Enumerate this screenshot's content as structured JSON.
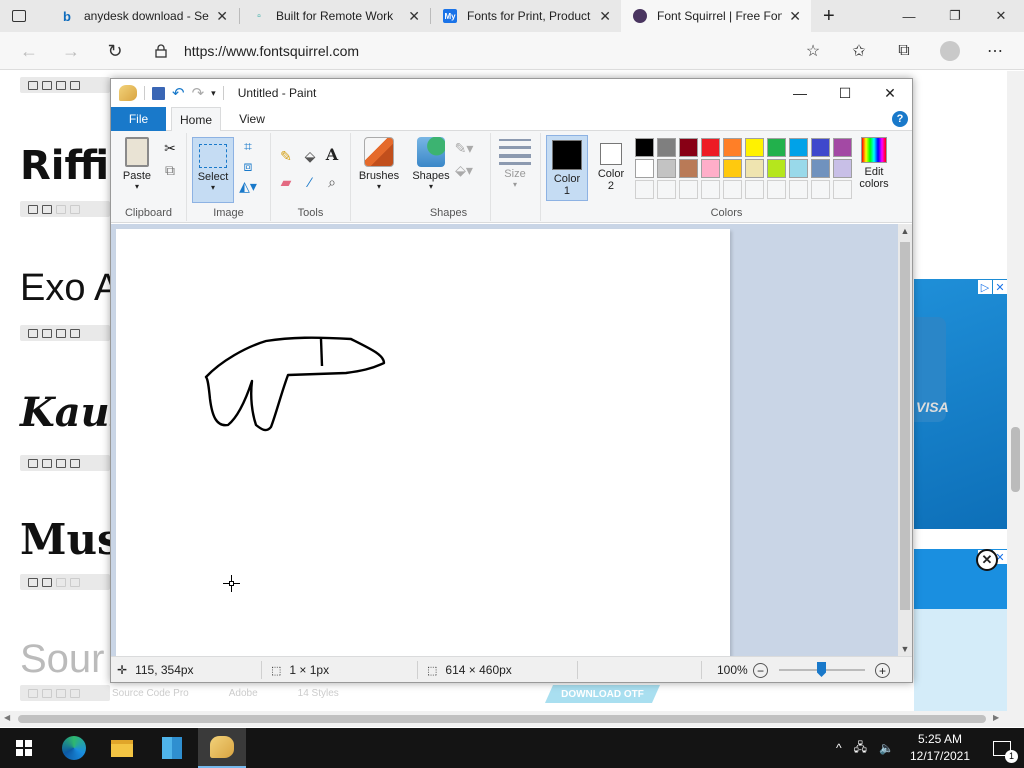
{
  "browser": {
    "tabs": [
      {
        "label": "anydesk download - Se",
        "favicon": "bing-icon",
        "color": "#0f6cbd"
      },
      {
        "label": "Built for Remote Work",
        "favicon": "anydesk-icon",
        "color": "#1aa39a"
      },
      {
        "label": "Fonts for Print, Product",
        "favicon": "myfonts-icon",
        "color": "#1a73e8"
      },
      {
        "label": "Font Squirrel | Free Font",
        "favicon": "fontsquirrel-icon",
        "color": "#4a3560"
      }
    ],
    "url": "https://www.fontsquirrel.com"
  },
  "page": {
    "fonts": [
      "Riffic",
      "Exo A",
      "Kaush",
      "Mus",
      "Sour"
    ],
    "bottom_strip": [
      "Source Code Pro",
      "Adobe",
      "14 Styles"
    ],
    "download_label": "DOWNLOAD OTF",
    "ad_text": "VISA"
  },
  "paint": {
    "title": "Untitled - Paint",
    "tabs": {
      "file": "File",
      "home": "Home",
      "view": "View"
    },
    "groups": {
      "clipboard": "Clipboard",
      "image": "Image",
      "tools": "Tools",
      "shapes": "Shapes",
      "colors": "Colors"
    },
    "buttons": {
      "paste": "Paste",
      "select": "Select",
      "brushes": "Brushes",
      "shapes": "Shapes",
      "size": "Size",
      "color1": "Color\n1",
      "color2": "Color\n2",
      "edit_colors": "Edit\ncolors"
    },
    "palette_row1": [
      "#000000",
      "#7f7f7f",
      "#880015",
      "#ed1c24",
      "#ff7f27",
      "#fff200",
      "#22b14c",
      "#00a2e8",
      "#3f48cc",
      "#a349a4"
    ],
    "palette_row2": [
      "#ffffff",
      "#c3c3c3",
      "#b97a57",
      "#ffaec9",
      "#ffc90e",
      "#efe4b0",
      "#b5e61d",
      "#99d9ea",
      "#7092be",
      "#c8bfe7"
    ],
    "color1": "#000000",
    "color2": "#ffffff",
    "status": {
      "cursor_pos": "115, 354px",
      "selection_size": "1 × 1px",
      "image_size": "614 × 460px",
      "zoom": "100%"
    }
  },
  "taskbar": {
    "time": "5:25 AM",
    "date": "12/17/2021",
    "notification_count": "1"
  }
}
